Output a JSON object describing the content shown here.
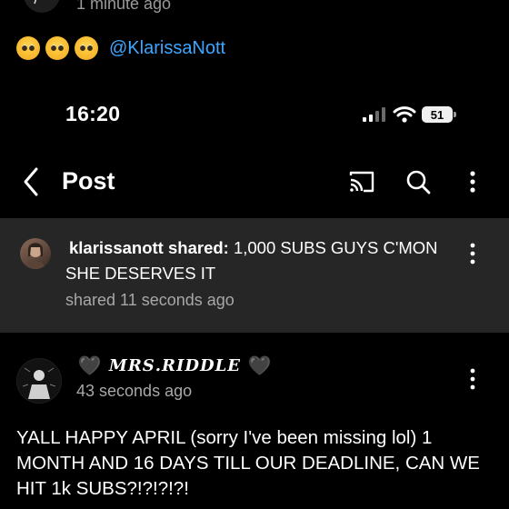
{
  "top_comment": {
    "time": "1 minute ago",
    "emojis": [
      "pleading-face",
      "pleading-face",
      "pleading-face"
    ],
    "mention": "@KlarissaNott"
  },
  "status_bar": {
    "time": "16:20",
    "battery": "51"
  },
  "header": {
    "title": "Post",
    "icons": [
      "back-chevron",
      "cast",
      "search",
      "more-vertical"
    ]
  },
  "shared_post": {
    "username": "klarissanott",
    "action": " shared:",
    "text_line1": " 1,000 SUBS GUYS C'MON",
    "text_line2": "SHE DESERVES IT",
    "time": "shared 11 seconds ago"
  },
  "post": {
    "author": "𝑴𝑹𝑺.𝑹𝑰𝑫𝑫𝑳𝑬",
    "hearts": "🖤",
    "time": "43 seconds ago",
    "body": "YALL HAPPY APRIL (sorry I've been missing lol) 1 MONTH AND 16 DAYS TILL OUR DEADLINE, CAN WE HIT 1k SUBS?!?!?!?!"
  },
  "colors": {
    "background": "#000000",
    "card": "#262626",
    "link": "#3ea6ff",
    "secondary_text": "#a8a8a8"
  }
}
